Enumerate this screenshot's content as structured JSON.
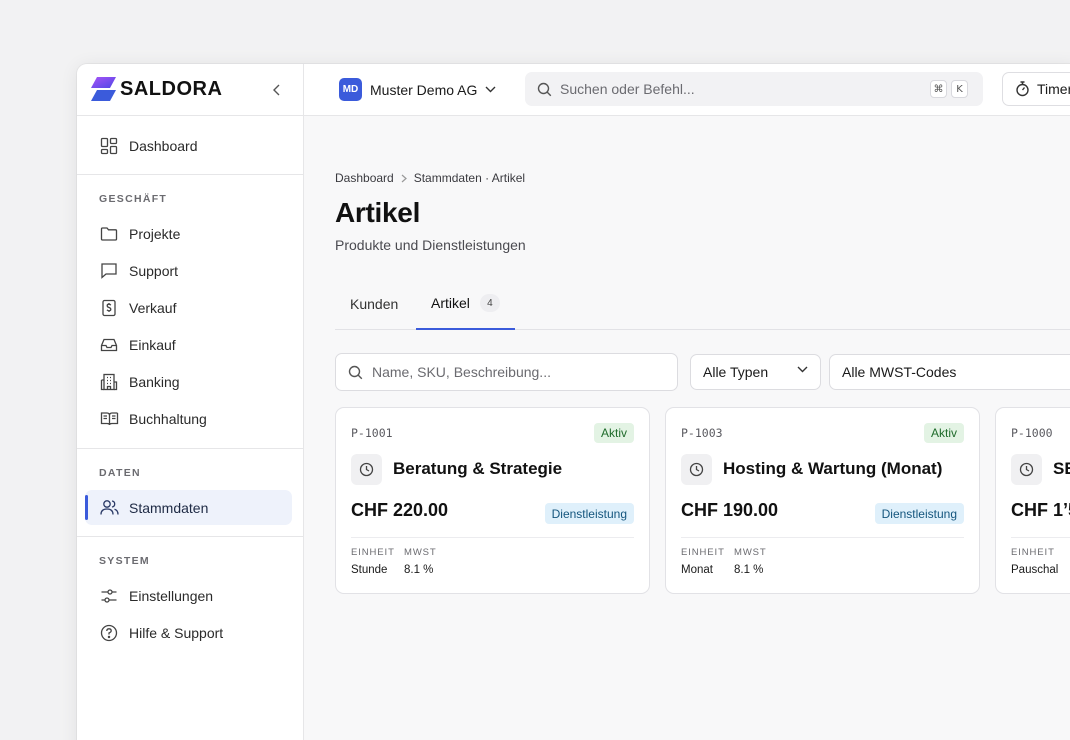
{
  "app": {
    "brand": "SALDORA",
    "brand_colors": {
      "primary": "#3b5bdb",
      "gradient_start": "#7c3aed",
      "gradient_end": "#4f46e5"
    }
  },
  "sidebar": {
    "dashboard": {
      "label": "Dashboard",
      "icon": "dashboard-icon"
    },
    "sections": [
      {
        "title": "GESCHÄFT",
        "items": [
          {
            "label": "Projekte",
            "icon": "folder-icon"
          },
          {
            "label": "Support",
            "icon": "chat-icon"
          },
          {
            "label": "Verkauf",
            "icon": "receipt-icon"
          },
          {
            "label": "Einkauf",
            "icon": "inbox-icon"
          },
          {
            "label": "Banking",
            "icon": "bank-icon"
          },
          {
            "label": "Buchhaltung",
            "icon": "book-icon"
          }
        ]
      },
      {
        "title": "DATEN",
        "items": [
          {
            "label": "Stammdaten",
            "icon": "users-icon",
            "active": true
          }
        ]
      },
      {
        "title": "SYSTEM",
        "items": [
          {
            "label": "Einstellungen",
            "icon": "sliders-icon"
          },
          {
            "label": "Hilfe & Support",
            "icon": "help-icon"
          }
        ]
      }
    ]
  },
  "topbar": {
    "org_initials": "MD",
    "org_name": "Muster Demo AG",
    "search_placeholder": "Suchen oder Befehl...",
    "shortcut_keys": [
      "⌘",
      "K"
    ],
    "timer_label": "Timer"
  },
  "breadcrumb": {
    "root": "Dashboard",
    "current": "Stammdaten · Artikel"
  },
  "page": {
    "title": "Artikel",
    "subtitle": "Produkte und Dienstleistungen"
  },
  "tabs": [
    {
      "label": "Kunden"
    },
    {
      "label": "Artikel",
      "count": "4",
      "active": true
    }
  ],
  "filters": {
    "search_placeholder": "Name, SKU, Beschreibung...",
    "type_select": "Alle Typen",
    "vat_select": "Alle MWST-Codes"
  },
  "cards": [
    {
      "sku": "P-1001",
      "status": "Aktiv",
      "name": "Beratung & Strategie",
      "price": "CHF 220.00",
      "type": "Dienstleistung",
      "unit_label": "EINHEIT",
      "unit": "Stunde",
      "vat_label": "MWST",
      "vat": "8.1 %"
    },
    {
      "sku": "P-1003",
      "status": "Aktiv",
      "name": "Hosting & Wartung (Monat)",
      "price": "CHF 190.00",
      "type": "Dienstleistung",
      "unit_label": "EINHEIT",
      "unit": "Monat",
      "vat_label": "MWST",
      "vat": "8.1 %"
    },
    {
      "sku": "P-1000",
      "name": "SE",
      "price": "CHF 1’5",
      "unit_label": "EINHEIT",
      "unit": "Pauschal"
    }
  ]
}
